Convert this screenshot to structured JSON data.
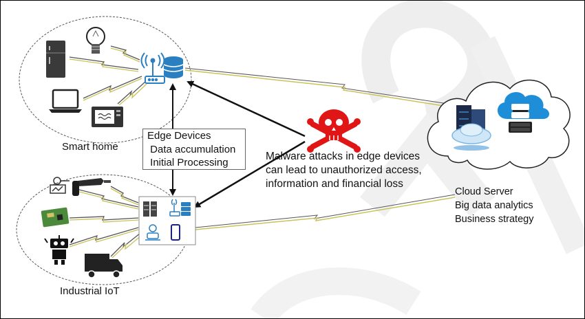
{
  "smart_home": {
    "label": "Smart home"
  },
  "industrial_iot": {
    "label": "Industrial IoT"
  },
  "edge_box": {
    "lines": [
      "Edge Devices",
      " Data accumulation",
      " Initial Processing"
    ]
  },
  "malware": {
    "lines": [
      "Malware attacks in edge devices",
      "can lead to unauthorized access,",
      "information and financial loss"
    ]
  },
  "cloud": {
    "lines": [
      "Cloud Server",
      "Big data analytics",
      "Business strategy"
    ]
  },
  "colors": {
    "device_blue": "#2a7fc1",
    "skull_red": "#e01515",
    "cloud_blue": "#1f8ed8",
    "dark": "#222222"
  },
  "icons": [
    "fridge-icon",
    "lightbulb-icon",
    "laptop-icon",
    "microwave-icon",
    "wifi-router-icon",
    "database-icon",
    "server-rack-icon",
    "smartphone-icon",
    "robot-icon",
    "truck-icon",
    "circuit-board-icon",
    "drill-icon",
    "plug-icon",
    "skull-crossbones-icon",
    "cloud-server-icon",
    "cloud-database-icon"
  ]
}
